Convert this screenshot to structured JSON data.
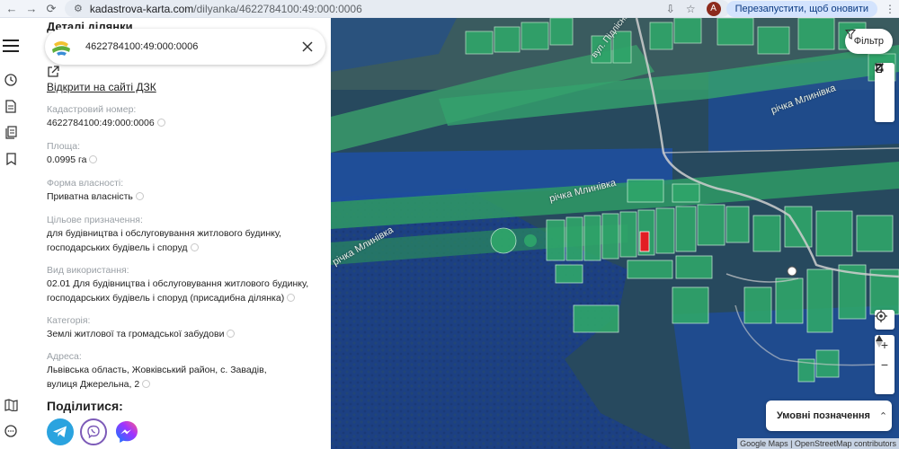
{
  "browser": {
    "url_host": "kadastrova-karta.com",
    "url_path": "/dilyanka/4622784100:49:000:0006",
    "avatar_letter": "A",
    "restart_label": "Перезапустити, щоб оновити"
  },
  "panel": {
    "title": "Деталі ділянки",
    "search_value": "4622784100:49:000:0006",
    "dzk_link": "Відкрити на сайті ДЗК",
    "fields": [
      {
        "label": "Кадастровий номер:",
        "value": "4622784100:49:000:0006"
      },
      {
        "label": "Площа:",
        "value": "0.0995 га"
      },
      {
        "label": "Форма власності:",
        "value": "Приватна власність"
      },
      {
        "label": "Цільове призначення:",
        "value": "для будівництва і обслуговування житлового будинку, господарських будівель і споруд"
      },
      {
        "label": "Вид використання:",
        "value": "02.01 Для будівництва і обслуговування житлового будинку, господарських будівель і споруд (присадибна ділянка)"
      },
      {
        "label": "Категорія:",
        "value": "Землі житлової та громадської забудови"
      },
      {
        "label": "Адреса:",
        "value": "Львівська область, Жовківський район, с. Завадів, вулиця Джерельна, 2"
      }
    ],
    "share_title": "Поділитися:"
  },
  "map": {
    "filter_label": "Фільтр",
    "legend_label": "Умовні позначення",
    "attribution": "Google Maps | OpenStreetMap contributors",
    "labels": {
      "street_top": "вул. Підлісна",
      "river_right": "річка Млинівка",
      "river_mid": "річка Млинівка",
      "river_left": "річка Млинівка"
    },
    "colors": {
      "parcel_fill": "#2fa66a",
      "selected_parcel": "#e31e24",
      "water_overlay": "#1f4f9e"
    }
  }
}
